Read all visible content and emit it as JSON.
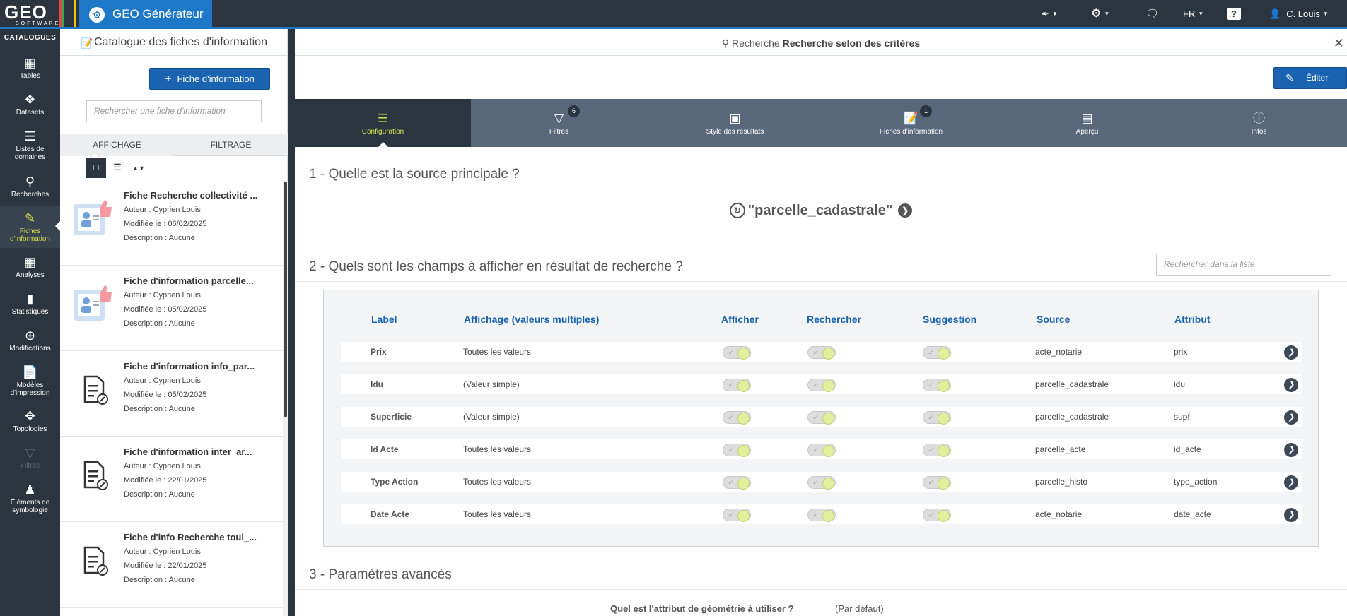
{
  "topbar": {
    "logo_text": "GEO",
    "logo_sub": "SOFTWARE",
    "app_title": "GEO Générateur",
    "lang": "FR",
    "user": "C. Louis",
    "accent": "#1e78c8"
  },
  "nav": {
    "header": "CATALOGUES",
    "items": [
      {
        "label": "Tables",
        "icon": "grid-icon"
      },
      {
        "label": "Datasets",
        "icon": "network-icon"
      },
      {
        "label": "Listes de domaines",
        "icon": "list-icon"
      },
      {
        "label": "Recherches",
        "icon": "search-icon"
      },
      {
        "label": "Fiches d'information",
        "icon": "info-sheet-icon"
      },
      {
        "label": "Analyses",
        "icon": "analysis-icon"
      },
      {
        "label": "Statistiques",
        "icon": "chart-icon"
      },
      {
        "label": "Modifications",
        "icon": "edit-globe-icon"
      },
      {
        "label": "Modèles d'impression",
        "icon": "pdf-icon"
      },
      {
        "label": "Topologies",
        "icon": "topology-icon"
      },
      {
        "label": "Filtres",
        "icon": "filter-icon"
      },
      {
        "label": "Éléments de symbologie",
        "icon": "stamp-icon"
      }
    ]
  },
  "catalogue": {
    "title": "Catalogue des fiches d'information",
    "new_button": "Fiche d'information",
    "search_placeholder": "Rechercher une fiche d'information",
    "tab_display": "AFFICHAGE",
    "tab_filter": "FILTRAGE",
    "cards": [
      {
        "title": "Fiche Recherche collectivité ...",
        "author": "Auteur : Cyprien Louis",
        "modified": "Modifiée le : 06/02/2025",
        "description": "Description : Aucune"
      },
      {
        "title": "Fiche d'information parcelle...",
        "author": "Auteur : Cyprien Louis",
        "modified": "Modifiée le : 05/02/2025",
        "description": "Description : Aucune"
      },
      {
        "title": "Fiche d'information info_par...",
        "author": "Auteur : Cyprien Louis",
        "modified": "Modifiée le : 05/02/2025",
        "description": "Description : Aucune"
      },
      {
        "title": "Fiche d'information inter_ar...",
        "author": "Auteur : Cyprien Louis",
        "modified": "Modifiée le : 22/01/2025",
        "description": "Description : Aucune"
      },
      {
        "title": "Fiche d'info Recherche toul_...",
        "author": "Auteur : Cyprien Louis",
        "modified": "Modifiée le : 22/01/2025",
        "description": "Description : Aucune"
      }
    ]
  },
  "main": {
    "header_prefix": "Recherche",
    "header_title": "Recherche selon des critères",
    "edit_button": "Éditer",
    "steps": [
      {
        "label": "Configuration",
        "icon": "menu-icon",
        "badge": ""
      },
      {
        "label": "Filtres",
        "icon": "filter-icon",
        "badge": "6"
      },
      {
        "label": "Style des résultats",
        "icon": "layout-icon",
        "badge": ""
      },
      {
        "label": "Fiches d'information",
        "icon": "info-sheet-icon",
        "badge": "1"
      },
      {
        "label": "Aperçu",
        "icon": "preview-icon",
        "badge": ""
      },
      {
        "label": "Infos",
        "icon": "info-icon",
        "badge": ""
      }
    ],
    "section1": "1 - Quelle est la source principale ?",
    "source_name": "\"parcelle_cadastrale\"",
    "section2": "2 - Quels sont les champs à afficher en résultat de recherche ?",
    "list_search_placeholder": "Rechercher dans la liste",
    "columns": [
      "Label",
      "Affichage (valeurs multiples)",
      "Afficher",
      "Rechercher",
      "Suggestion",
      "Source",
      "Attribut"
    ],
    "rows": [
      {
        "label": "Prix",
        "display": "Toutes les valeurs",
        "source": "acte_notarie",
        "attribute": "prix"
      },
      {
        "label": "Idu",
        "display": "(Valeur simple)",
        "source": "parcelle_cadastrale",
        "attribute": "idu"
      },
      {
        "label": "Superficie",
        "display": "(Valeur simple)",
        "source": "parcelle_cadastrale",
        "attribute": "supf"
      },
      {
        "label": "Id Acte",
        "display": "Toutes les valeurs",
        "source": "parcelle_acte",
        "attribute": "id_acte"
      },
      {
        "label": "Type Action",
        "display": "Toutes les valeurs",
        "source": "parcelle_histo",
        "attribute": "type_action"
      },
      {
        "label": "Date Acte",
        "display": "Toutes les valeurs",
        "source": "acte_notarie",
        "attribute": "date_acte"
      }
    ],
    "section3": "3 - Paramètres avancés",
    "geom_question": "Quel est l'attribut de géométrie à utiliser ?",
    "geom_value": "(Par défaut)"
  }
}
